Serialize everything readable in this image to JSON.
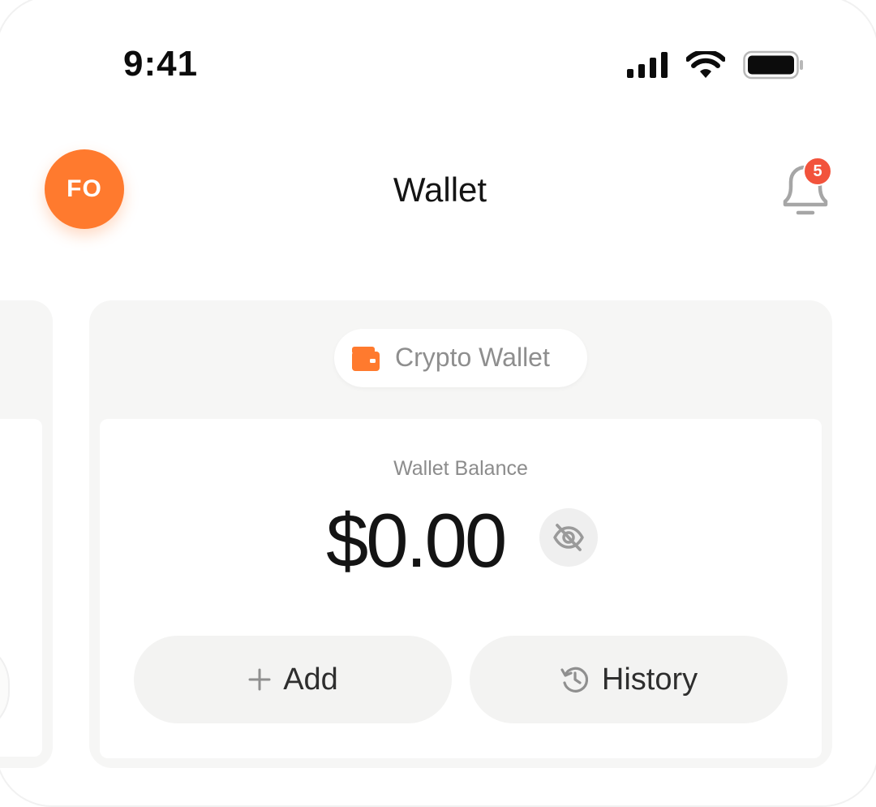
{
  "status_bar": {
    "time": "9:41",
    "icons": [
      "cellular-signal-icon",
      "wifi-icon",
      "battery-icon"
    ]
  },
  "header": {
    "avatar_initials": "FO",
    "title": "Wallet",
    "notification_count": "5"
  },
  "wallet_card": {
    "chip_label": "Crypto Wallet",
    "chip_icon": "wallet-icon",
    "balance_label": "Wallet Balance",
    "balance_amount": "$0.00",
    "visibility_icon": "eye-off-icon",
    "actions": {
      "add_label": "Add",
      "add_icon": "plus-icon",
      "history_label": "History",
      "history_icon": "history-icon"
    }
  },
  "colors": {
    "accent": "#ff7a2e",
    "badge": "#f2533c",
    "card_bg": "#f6f6f5",
    "text_primary": "#141414",
    "text_secondary": "#8c8c8c"
  }
}
